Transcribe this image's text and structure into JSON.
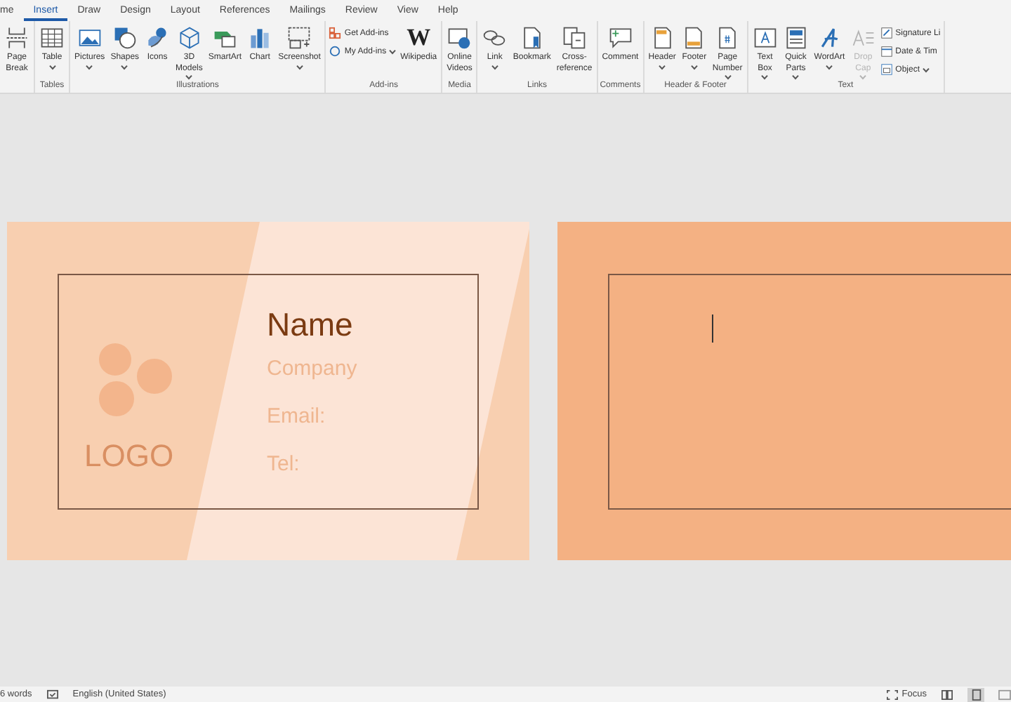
{
  "ribbon_tabs": [
    {
      "label": "me",
      "selected": false
    },
    {
      "label": "Insert",
      "selected": true
    },
    {
      "label": "Draw",
      "selected": false
    },
    {
      "label": "Design",
      "selected": false
    },
    {
      "label": "Layout",
      "selected": false
    },
    {
      "label": "References",
      "selected": false
    },
    {
      "label": "Mailings",
      "selected": false
    },
    {
      "label": "Review",
      "selected": false
    },
    {
      "label": "View",
      "selected": false
    },
    {
      "label": "Help",
      "selected": false
    }
  ],
  "ribbon_groups": [
    {
      "items": [
        {
          "kind": "large",
          "label": "Page Break",
          "caret": false
        }
      ]
    },
    {
      "label": "Tables",
      "items": [
        {
          "kind": "large",
          "label": "Table",
          "caret": true
        }
      ]
    },
    {
      "label": "Illustrations",
      "items": [
        {
          "kind": "large",
          "label": "Pictures",
          "caret": true
        },
        {
          "kind": "large",
          "label": "Shapes",
          "caret": true
        },
        {
          "kind": "large",
          "label": "Icons",
          "caret": false
        },
        {
          "kind": "large",
          "label": "3D Models",
          "caret": true
        },
        {
          "kind": "large",
          "label": "SmartArt",
          "caret": false
        },
        {
          "kind": "large",
          "label": "Chart",
          "caret": false
        },
        {
          "kind": "large",
          "label": "Screenshot",
          "caret": true
        }
      ]
    },
    {
      "label": "Add-ins",
      "items": [
        {
          "kind": "small",
          "label": "Get Add-ins",
          "caret": false
        },
        {
          "kind": "small",
          "label": "My Add-ins",
          "caret": true
        },
        {
          "kind": "large",
          "label": "Wikipedia",
          "caret": false,
          "glyph": "W"
        }
      ]
    },
    {
      "label": "Media",
      "items": [
        {
          "kind": "large",
          "label": "Online Videos",
          "caret": false
        }
      ]
    },
    {
      "label": "Links",
      "items": [
        {
          "kind": "large",
          "label": "Link",
          "caret": true
        },
        {
          "kind": "large",
          "label": "Bookmark",
          "caret": false
        },
        {
          "kind": "large",
          "label": "Cross-reference",
          "caret": false
        }
      ]
    },
    {
      "label": "Comments",
      "items": [
        {
          "kind": "large",
          "label": "Comment",
          "caret": false
        }
      ]
    },
    {
      "label": "Header & Footer",
      "items": [
        {
          "kind": "large",
          "label": "Header",
          "caret": true
        },
        {
          "kind": "large",
          "label": "Footer",
          "caret": true
        },
        {
          "kind": "large",
          "label": "Page Number",
          "caret": true
        }
      ]
    },
    {
      "label": "Text",
      "items": [
        {
          "kind": "large",
          "label": "Text Box",
          "caret": true
        },
        {
          "kind": "large",
          "label": "Quick Parts",
          "caret": true
        },
        {
          "kind": "large",
          "label": "WordArt",
          "caret": true
        },
        {
          "kind": "large",
          "label": "Drop Cap",
          "caret": true,
          "disabled": true
        },
        {
          "kind": "small",
          "label": "Signature Li",
          "caret": false
        },
        {
          "kind": "small",
          "label": "Date & Tim",
          "caret": false
        },
        {
          "kind": "small",
          "label": "Object",
          "caret": true
        }
      ]
    }
  ],
  "cards": [
    {
      "kind": "template",
      "logo": "LOGO",
      "name": "Name",
      "company": "Company",
      "email": "Email:",
      "tel": "Tel:"
    },
    {
      "kind": "blank",
      "cursor": true
    }
  ],
  "status_bar": {
    "word_count": "6 words",
    "language": "English (United States)",
    "focus": "Focus"
  }
}
